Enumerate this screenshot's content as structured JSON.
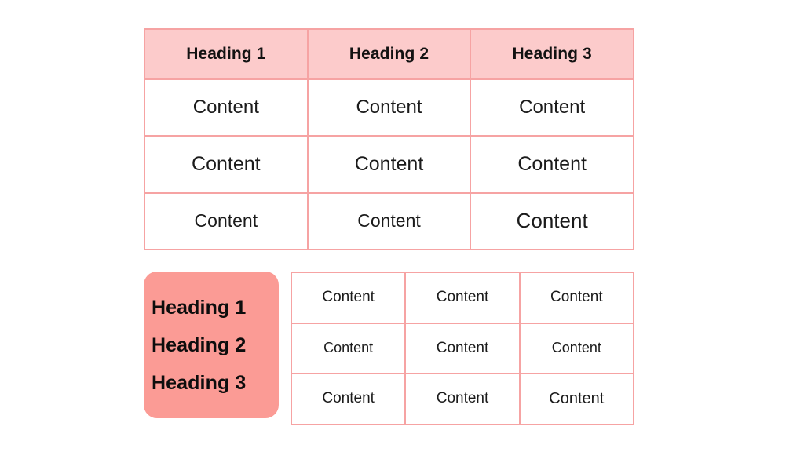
{
  "colors": {
    "header_fill": "#FCCBCB",
    "border": "#F6A3A3",
    "heading_block_fill": "#FB9B95",
    "page_background": "#FFFFFF",
    "text": "#111111"
  },
  "top_table": {
    "headers": [
      "Heading 1",
      "Heading 2",
      "Heading 3"
    ],
    "rows": [
      [
        "Content",
        "Content",
        "Content"
      ],
      [
        "Content",
        "Content",
        "Content"
      ],
      [
        "Content",
        "Content",
        "Content"
      ]
    ]
  },
  "bottom_section": {
    "heading_block": {
      "lines": [
        "Heading 1",
        "Heading 2",
        "Heading 3"
      ]
    },
    "grid": {
      "rows": [
        [
          "Content",
          "Content",
          "Content"
        ],
        [
          "Content",
          "Content",
          "Content"
        ],
        [
          "Content",
          "Content",
          "Content"
        ]
      ]
    }
  }
}
